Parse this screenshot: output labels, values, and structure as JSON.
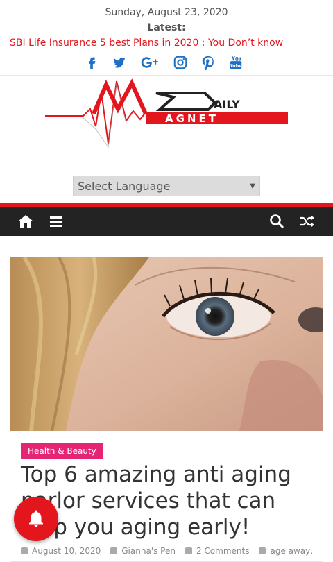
{
  "header": {
    "date": "Sunday, August 23, 2020",
    "latest_label": "Latest:",
    "ticker_text": "SBI Life Insurance 5 best Plans in 2020 : You Don’t know"
  },
  "social": [
    "facebook-icon",
    "twitter-icon",
    "google-plus-icon",
    "instagram-icon",
    "pinterest-icon",
    "youtube-icon"
  ],
  "logo": {
    "text_top": "AILY",
    "text_bottom": "AGNET"
  },
  "language": {
    "selected": "Select Language"
  },
  "nav": {
    "home_icon": "home-icon",
    "menu_icon": "menu-icon",
    "search_icon": "search-icon",
    "random_icon": "shuffle-icon"
  },
  "post": {
    "category": "Health & Beauty",
    "title": "Top 6 amazing anti aging parlor services that can stop you aging early!",
    "date": "August 10, 2020",
    "author": "Gianna's Pen",
    "comments": "2 Comments",
    "tags": "age away,"
  },
  "colors": {
    "accent": "#e3161d",
    "category": "#e52474",
    "nav_bg": "#232323",
    "social": "#1f6fc7"
  }
}
